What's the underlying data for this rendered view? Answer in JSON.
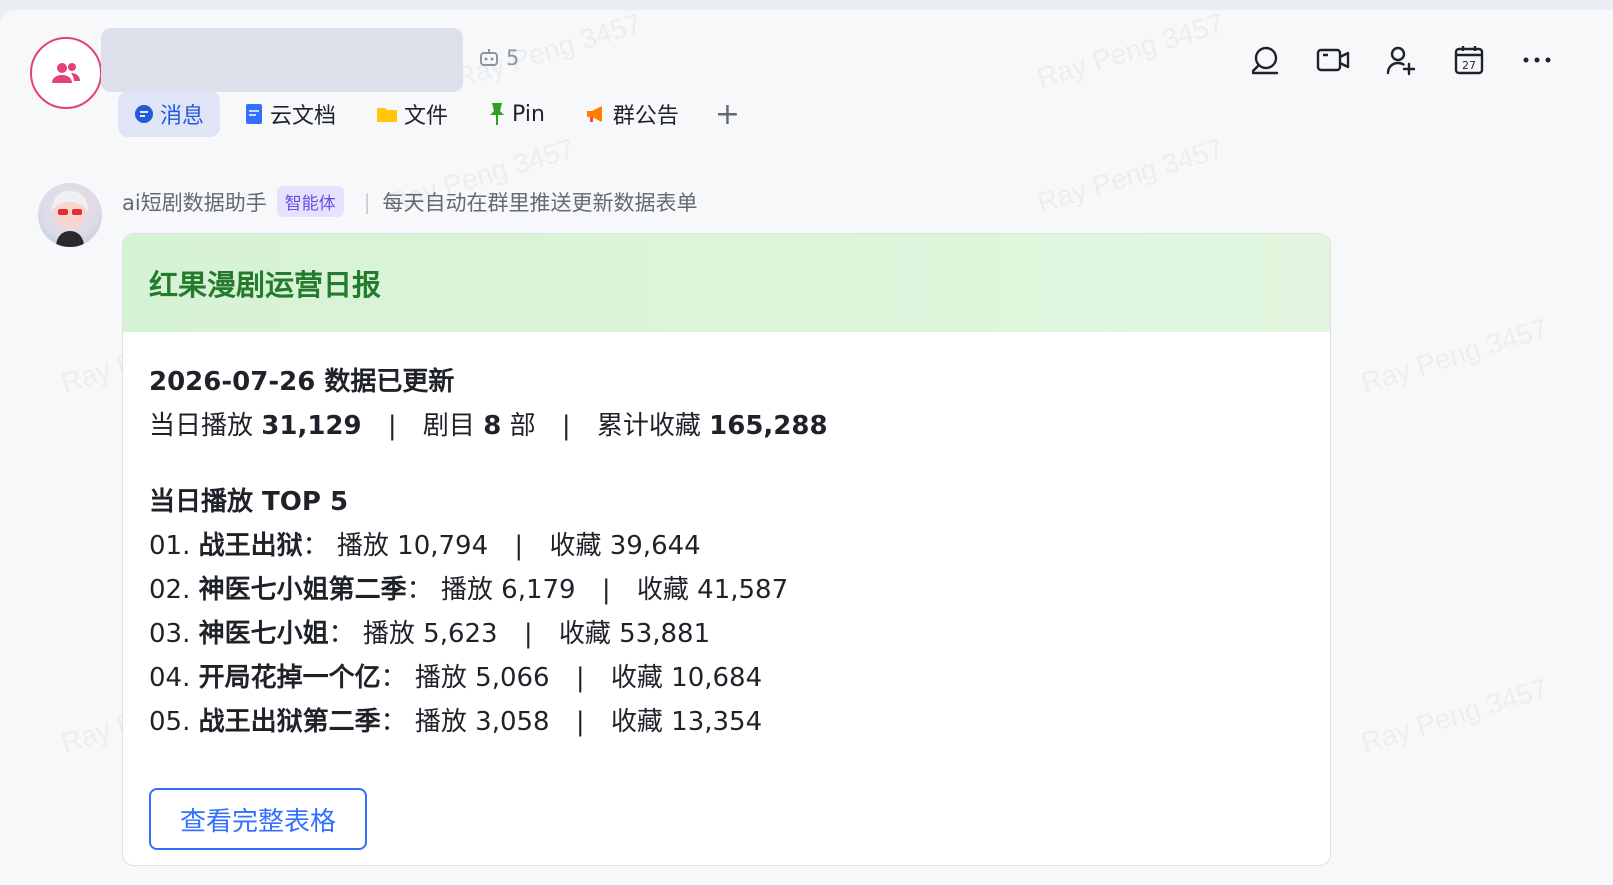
{
  "header": {
    "bot_count": "5",
    "tabs": [
      {
        "label": "消息",
        "icon": "chat-bubble-icon"
      },
      {
        "label": "云文档",
        "icon": "doc-icon"
      },
      {
        "label": "文件",
        "icon": "folder-icon"
      },
      {
        "label": "Pin",
        "icon": "pin-icon"
      },
      {
        "label": "群公告",
        "icon": "megaphone-icon"
      }
    ],
    "add_tab_label": "+",
    "actions": [
      "search-icon",
      "video-call-icon",
      "add-member-icon",
      "calendar-icon",
      "more-icon"
    ],
    "calendar_day": "27"
  },
  "watermark": "Ray Peng 3457",
  "message": {
    "sender": "ai短剧数据助手",
    "badge": "智能体",
    "separator": "|",
    "description": "每天自动在群里推送更新数据表单",
    "card": {
      "title": "红果漫剧运营日报",
      "updated": "2026-07-26 数据已更新",
      "summary": {
        "play_label": "当日播放",
        "play_value": "31,129",
        "series_label": "剧目",
        "series_value": "8",
        "series_unit": "部",
        "fav_label": "累计收藏",
        "fav_value": "165,288"
      },
      "top_title": "当日播放 TOP 5",
      "top_items": [
        {
          "rank": "01.",
          "name": "战王出狱",
          "play": "播放 10,794",
          "fav": "收藏 39,644"
        },
        {
          "rank": "02.",
          "name": "神医七小姐第二季",
          "play": "播放 6,179",
          "fav": "收藏 41,587"
        },
        {
          "rank": "03.",
          "name": "神医七小姐",
          "play": "播放 5,623",
          "fav": "收藏 53,881"
        },
        {
          "rank": "04.",
          "name": "开局花掉一个亿",
          "play": "播放 5,066",
          "fav": "收藏 10,684"
        },
        {
          "rank": "05.",
          "name": "战王出狱第二季",
          "play": "播放 3,058",
          "fav": "收藏 13,354"
        }
      ],
      "button_label": "查看完整表格"
    }
  },
  "colors": {
    "accent": "#3370ff",
    "group_avatar": "#e4407b",
    "card_title": "#237b2b",
    "badge": "#6a4be6"
  }
}
